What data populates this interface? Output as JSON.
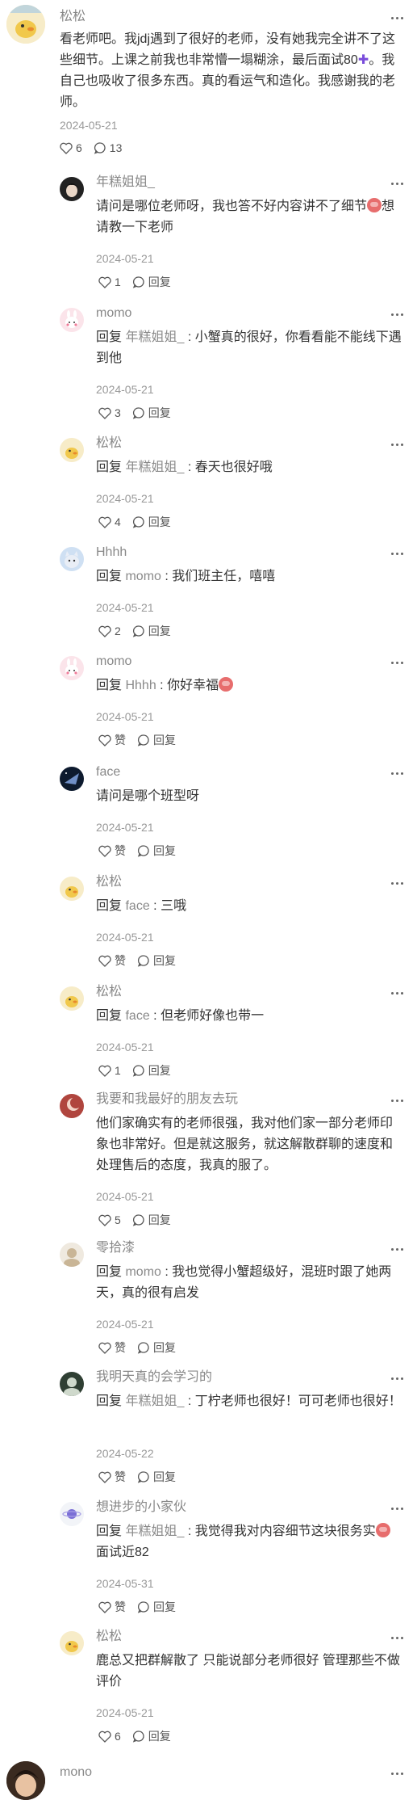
{
  "main_comment": {
    "author": "松松",
    "text": "看老师吧。我jdj遇到了很好的老师，没有她我完全讲不了这些细节。上课之前我也非常懵一塌糊涂，最后面试80",
    "text_after": "。我自己也吸收了很多东西。真的看运气和造化。我感谢我的老师。",
    "date": "2024-05-21",
    "likes": "6",
    "comments": "13"
  },
  "reply_label": "回复",
  "reply_action": "回复",
  "replies": [
    {
      "author": "年糕姐姐_",
      "prefix": "",
      "target": "",
      "text": "请问是哪位老师呀，我也答不好内容讲不了细节",
      "emoji_end": "想请教一下老师",
      "date": "2024-05-21",
      "likes": "1"
    },
    {
      "author": "momo",
      "prefix": "回复",
      "target": "年糕姐姐_",
      "text": "小蟹真的很好，你看看能不能线下遇到他",
      "date": "2024-05-21",
      "likes": "3"
    },
    {
      "author": "松松",
      "prefix": "回复",
      "target": "年糕姐姐_",
      "text": "春天也很好哦",
      "date": "2024-05-21",
      "likes": "4"
    },
    {
      "author": "Hhhh",
      "prefix": "回复",
      "target": "momo",
      "text": "我们班主任，嘻嘻",
      "date": "2024-05-21",
      "likes": "2"
    },
    {
      "author": "momo",
      "prefix": "回复",
      "target": "Hhhh",
      "text": "你好幸福",
      "date": "2024-05-21",
      "likes": "赞"
    },
    {
      "author": "face",
      "prefix": "",
      "target": "",
      "text": "请问是哪个班型呀",
      "date": "2024-05-21",
      "likes": "赞"
    },
    {
      "author": "松松",
      "prefix": "回复",
      "target": "face",
      "text": "三哦",
      "date": "2024-05-21",
      "likes": "赞"
    },
    {
      "author": "松松",
      "prefix": "回复",
      "target": "face",
      "text": "但老师好像也带一",
      "date": "2024-05-21",
      "likes": "1"
    },
    {
      "author": "我要和我最好的朋友去玩",
      "prefix": "",
      "target": "",
      "text": "他们家确实有的老师很强，我对他们家一部分老师印象也非常好。但是就这服务，就这解散群聊的速度和处理售后的态度，我真的服了。",
      "date": "2024-05-21",
      "likes": "5"
    },
    {
      "author": "零拾漆",
      "prefix": "回复",
      "target": "momo",
      "text": "我也觉得小蟹超级好，混班时跟了她两天，真的很有启发",
      "date": "2024-05-21",
      "likes": "赞"
    },
    {
      "author": "我明天真的会学习的",
      "prefix": "回复",
      "target": "年糕姐姐_",
      "text": "丁柠老师也很好！可可老师也很好！",
      "date": "2024-05-22",
      "likes": "赞"
    },
    {
      "author": "想进步的小家伙",
      "prefix": "回复",
      "target": "年糕姐姐_",
      "text": "我觉得我对内容细节这块很务实",
      "emoji_end": "面试近82",
      "date": "2024-05-31",
      "likes": "赞"
    },
    {
      "author": "松松",
      "prefix": "",
      "target": "",
      "text": "鹿总又把群解散了 只能说部分老师很好 管理那些不做评价",
      "date": "2024-05-21",
      "likes": "6"
    }
  ],
  "next_comment": {
    "author": "mono"
  }
}
